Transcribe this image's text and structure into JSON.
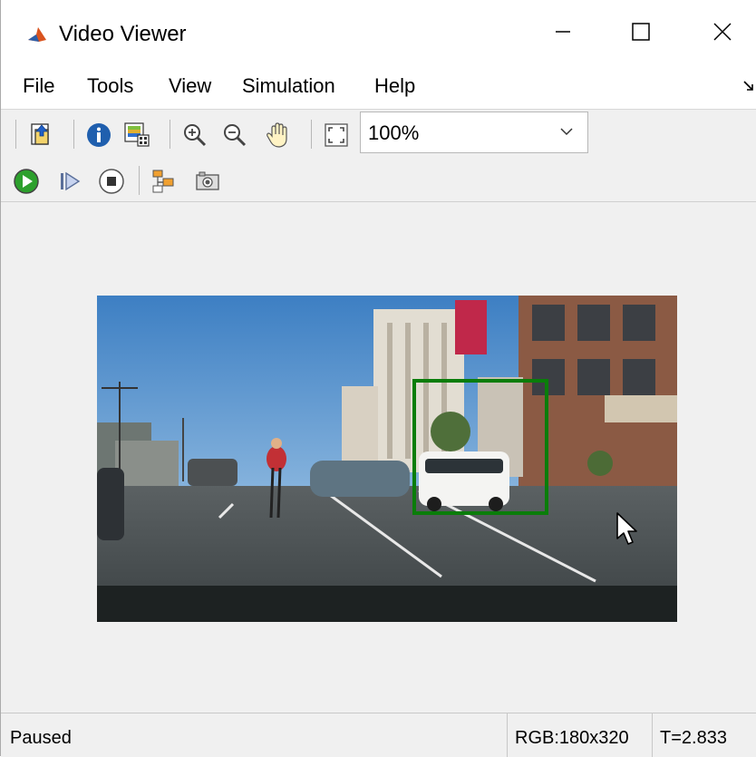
{
  "window": {
    "title": "Video Viewer"
  },
  "menu": {
    "items": [
      "File",
      "Tools",
      "View",
      "Simulation",
      "Help"
    ]
  },
  "toolbar": {
    "zoom_value": "100%"
  },
  "status": {
    "state": "Paused",
    "dims": "RGB:180x320",
    "time": "T=2.833"
  },
  "colors": {
    "bbox": "#0a7d0a",
    "play": "#2da02d"
  },
  "icons": {
    "toolbar1": [
      "bring-to-front-icon",
      "info-icon",
      "colormap-icon",
      "zoom-in-icon",
      "zoom-out-icon",
      "pan-hand-icon",
      "fit-to-window-icon"
    ],
    "toolbar2": [
      "play-icon",
      "step-forward-icon",
      "stop-icon",
      "highlight-simulink-icon",
      "snapshot-camera-icon"
    ]
  }
}
